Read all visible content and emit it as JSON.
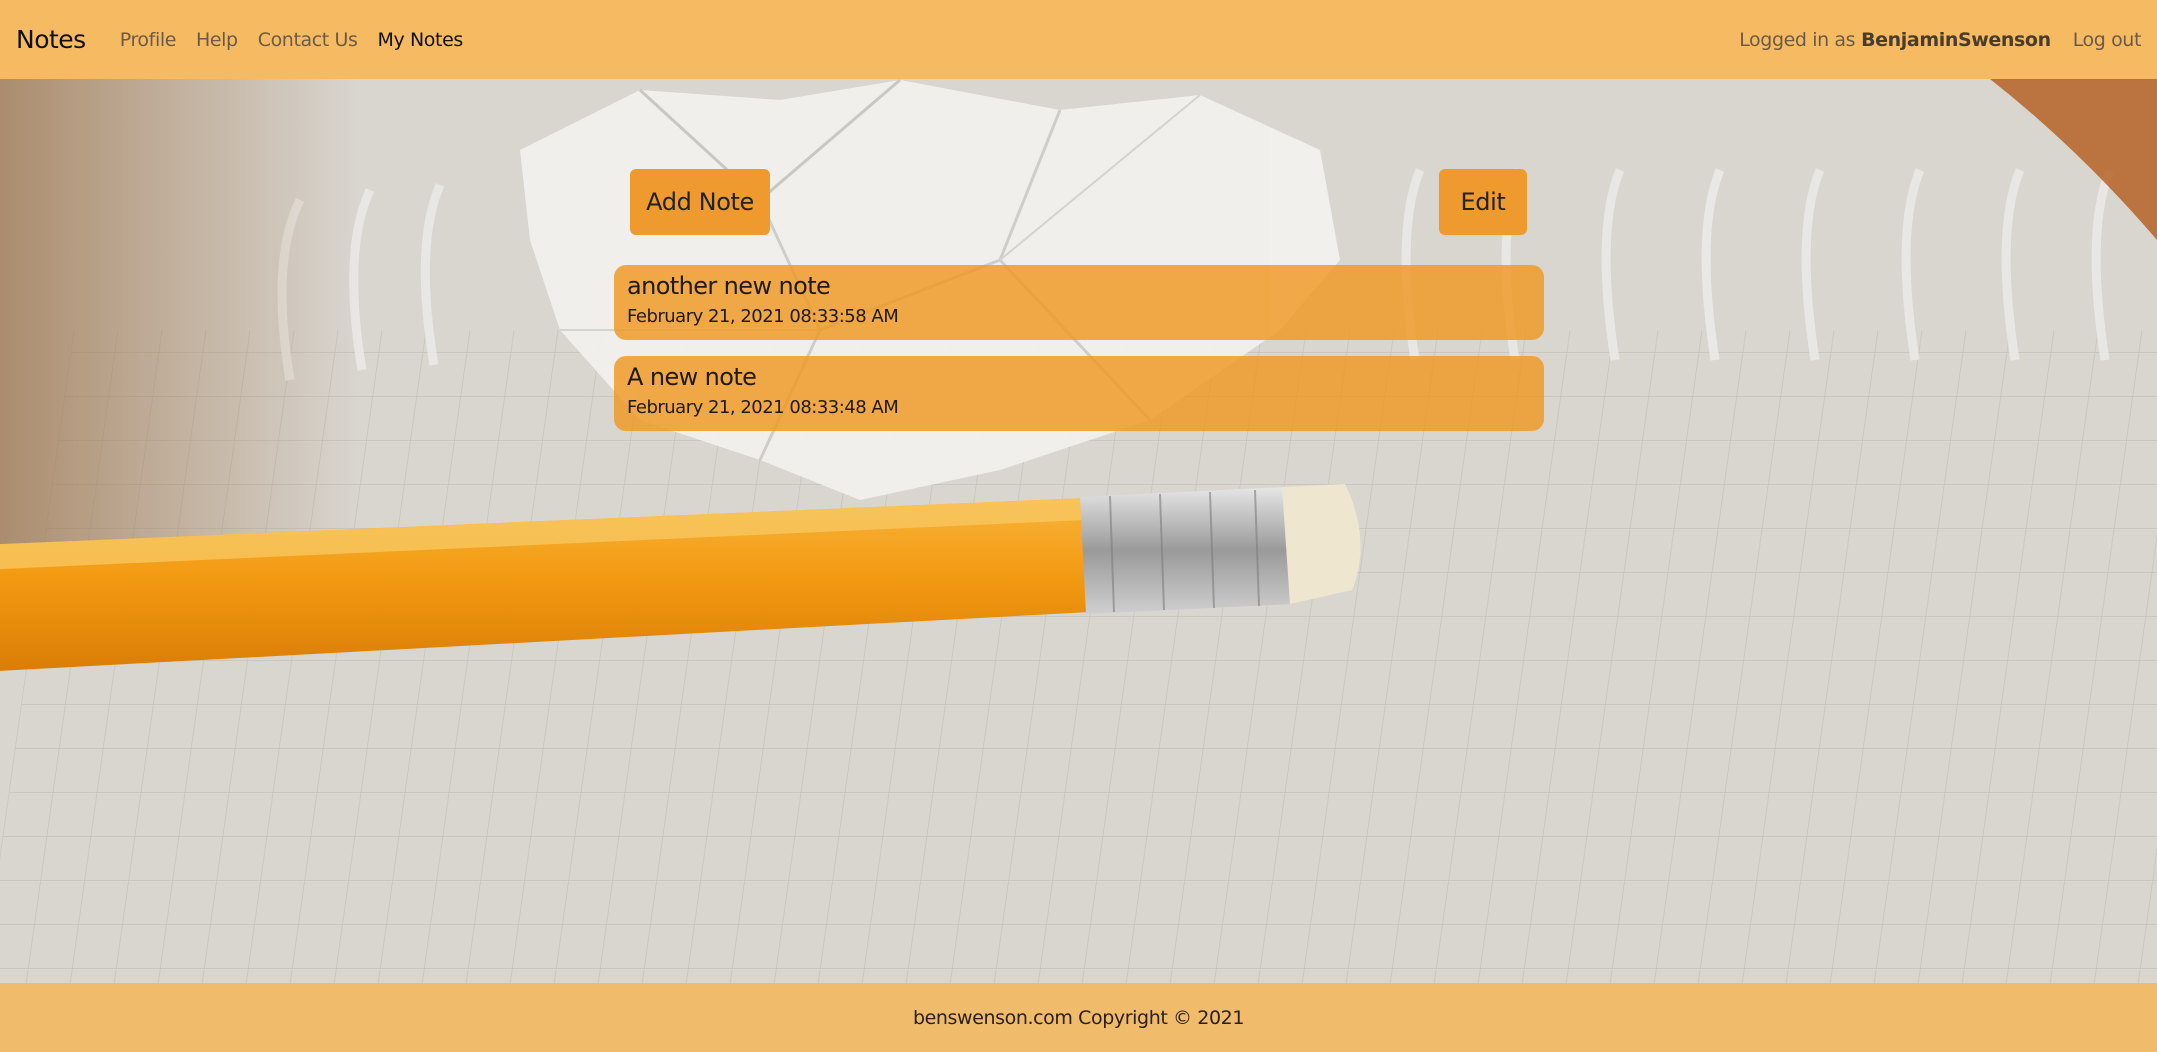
{
  "navbar": {
    "brand": "Notes",
    "links": [
      "Profile",
      "Help",
      "Contact Us",
      "My Notes"
    ],
    "active_link": "My Notes",
    "logged_in_prefix": "Logged in as",
    "username": "BenjaminSwenson",
    "logout_label": "Log out"
  },
  "toolbar": {
    "add_label": "Add Note",
    "edit_label": "Edit"
  },
  "notes": [
    {
      "title": "another new note",
      "date": "February 21, 2021 08:33:58 AM"
    },
    {
      "title": "A new note",
      "date": "February 21, 2021 08:33:48 AM"
    }
  ],
  "footer": {
    "text": "benswenson.com Copyright © 2021"
  },
  "colors": {
    "navbar": "#f6bb62",
    "accent": "#ee9a2e",
    "note_bg": "#f0961e",
    "footer": "#f0bc6c"
  }
}
